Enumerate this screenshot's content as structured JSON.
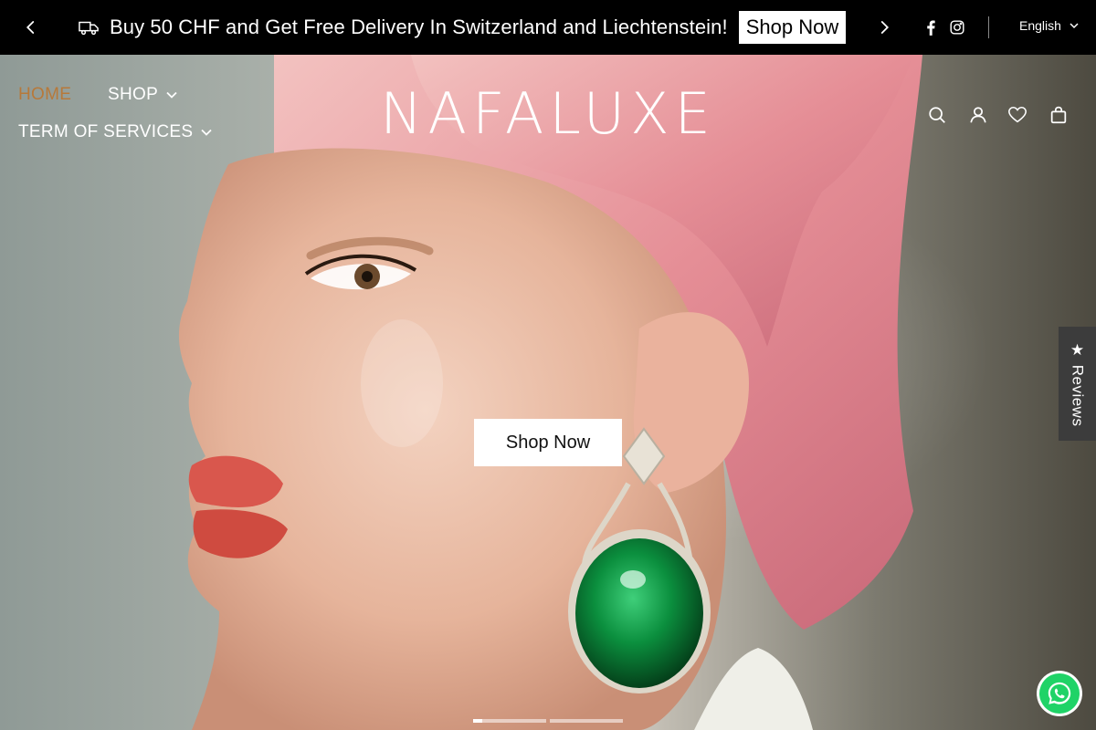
{
  "announcement": {
    "text": "Buy 50 CHF and Get Free Delivery In Switzerland and Liechtenstein!",
    "button_label": "Shop Now",
    "icon": "truck-icon",
    "prev_icon": "chevron-left-icon",
    "next_icon": "chevron-right-icon"
  },
  "social": [
    {
      "name": "facebook-icon"
    },
    {
      "name": "instagram-icon"
    }
  ],
  "language": {
    "selected": "English"
  },
  "nav": {
    "home": "HOME",
    "shop": "SHOP",
    "terms": "TERM OF SERVICES"
  },
  "brand": {
    "logo_text": "NAFALUXE"
  },
  "header_icons": [
    "search-icon",
    "account-icon",
    "heart-icon",
    "cart-icon"
  ],
  "hero": {
    "cta_label": "Shop Now"
  },
  "reviews_tab": {
    "label": "★ Reviews"
  },
  "slider": {
    "slides": 2,
    "active": 1,
    "progress": 0.12
  },
  "colors": {
    "announcement_bg": "#000000",
    "nav_active": "#b7793a",
    "reviews_bg": "#3c3c3c",
    "whatsapp": "#1fd367"
  }
}
